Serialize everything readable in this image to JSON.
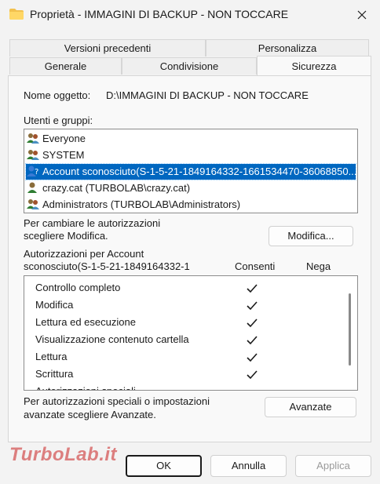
{
  "window": {
    "title": "Proprietà - IMMAGINI DI BACKUP - NON TOCCARE"
  },
  "tabs": {
    "row1": [
      {
        "label": "Versioni precedenti"
      },
      {
        "label": "Personalizza"
      }
    ],
    "row2": [
      {
        "label": "Generale"
      },
      {
        "label": "Condivisione"
      },
      {
        "label": "Sicurezza",
        "active": true
      }
    ]
  },
  "object": {
    "label": "Nome oggetto:",
    "value": "D:\\IMMAGINI DI BACKUP - NON TOCCARE"
  },
  "users": {
    "label": "Utenti e gruppi:",
    "items": [
      {
        "label": "Everyone",
        "icon": "group-icon"
      },
      {
        "label": "SYSTEM",
        "icon": "group-icon"
      },
      {
        "label": "Account sconosciuto(S-1-5-21-1849164332-1661534470-36068850...",
        "icon": "unknown-user-icon",
        "selected": true
      },
      {
        "label": "crazy.cat (TURBOLAB\\crazy.cat)",
        "icon": "user-icon"
      },
      {
        "label": "Administrators (TURBOLAB\\Administrators)",
        "icon": "group-icon"
      }
    ]
  },
  "change": {
    "line1": "Per cambiare le autorizzazioni",
    "line2": "scegliere Modifica.",
    "button": "Modifica..."
  },
  "permissions": {
    "title1": "Autorizzazioni per Account",
    "title2": "sconosciuto(S-1-5-21-1849164332-1",
    "allow_header": "Consenti",
    "deny_header": "Nega",
    "items": [
      {
        "label": "Controllo completo",
        "allow": true
      },
      {
        "label": "Modifica",
        "allow": true
      },
      {
        "label": "Lettura ed esecuzione",
        "allow": true
      },
      {
        "label": "Visualizzazione contenuto cartella",
        "allow": true
      },
      {
        "label": "Lettura",
        "allow": true
      },
      {
        "label": "Scrittura",
        "allow": true
      },
      {
        "label": "Autorizzazioni speciali",
        "allow": false
      }
    ]
  },
  "advanced": {
    "line1": "Per autorizzazioni speciali o impostazioni",
    "line2": "avanzate scegliere Avanzate.",
    "button": "Avanzate"
  },
  "footer": {
    "ok": "OK",
    "cancel": "Annulla",
    "apply": "Applica"
  },
  "watermark": "TurboLab.it",
  "colors": {
    "selection": "#0067c0",
    "background": "#f3f3f3",
    "panel": "#f9f9f9"
  }
}
